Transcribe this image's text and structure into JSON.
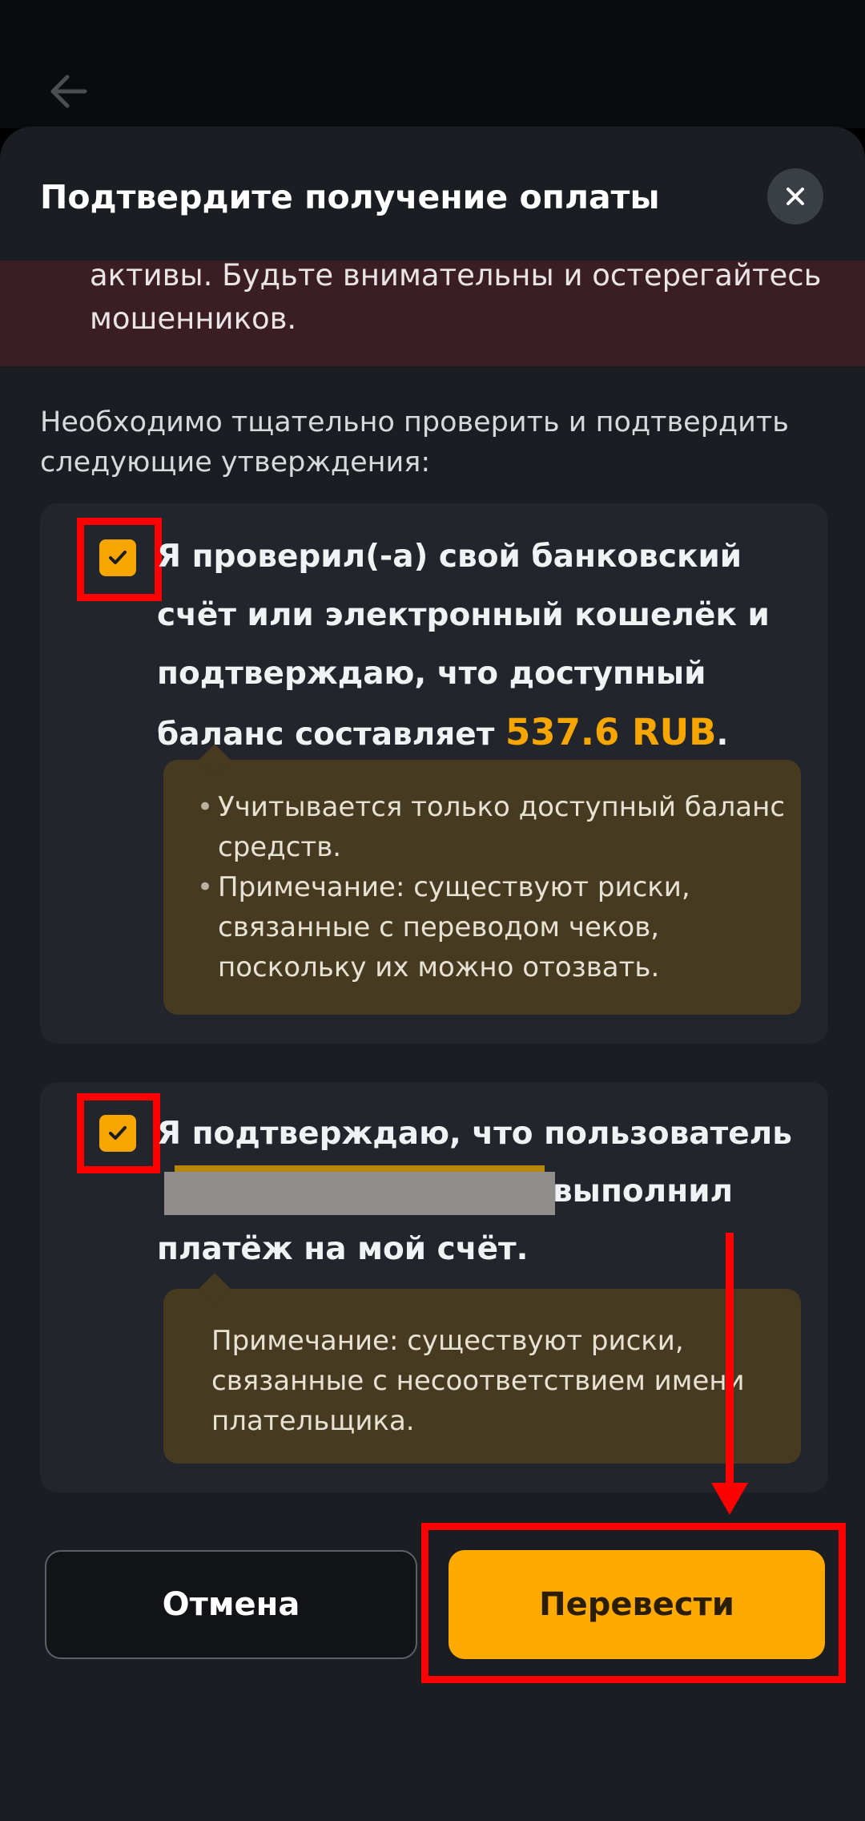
{
  "header": {
    "back_icon": "arrow-left-icon"
  },
  "sheet": {
    "title": "Подтвердите получение оплаты",
    "close_icon": "close-icon"
  },
  "warning": {
    "line1": "активы. Будьте внимательны и остерегайтесь",
    "line2": "мошенников."
  },
  "intro": "Необходимо тщательно проверить и подтвердить следующие утверждения:",
  "statements": [
    {
      "checked": true,
      "text_line1": "Я проверил(-а) свой банковский",
      "text_line2": "счёт или электронный кошелёк и",
      "text_line3": "подтверждаю, что доступный",
      "text_line4_prefix": "баланс составляет ",
      "amount": "537.6 RUB",
      "text_line4_suffix": ".",
      "notes": [
        "Учитывается только доступный баланс средств.",
        "Примечание: существуют риски, связанные с переводом чеков, поскольку их можно отозвать."
      ]
    },
    {
      "checked": true,
      "text_line1": "Я подтверждаю, что пользователь",
      "text_line2_suffix": "выполнил",
      "text_line3": "платёж на мой счёт.",
      "note": "Примечание: существуют риски, связанные с несоответствием имени плательщика."
    }
  ],
  "buttons": {
    "cancel": "Отмена",
    "confirm": "Перевести"
  },
  "colors": {
    "accent": "#f7a600",
    "annotation": "#ff0000",
    "sheet_bg": "#1a1d22",
    "warning_bg": "#3a1e24"
  }
}
